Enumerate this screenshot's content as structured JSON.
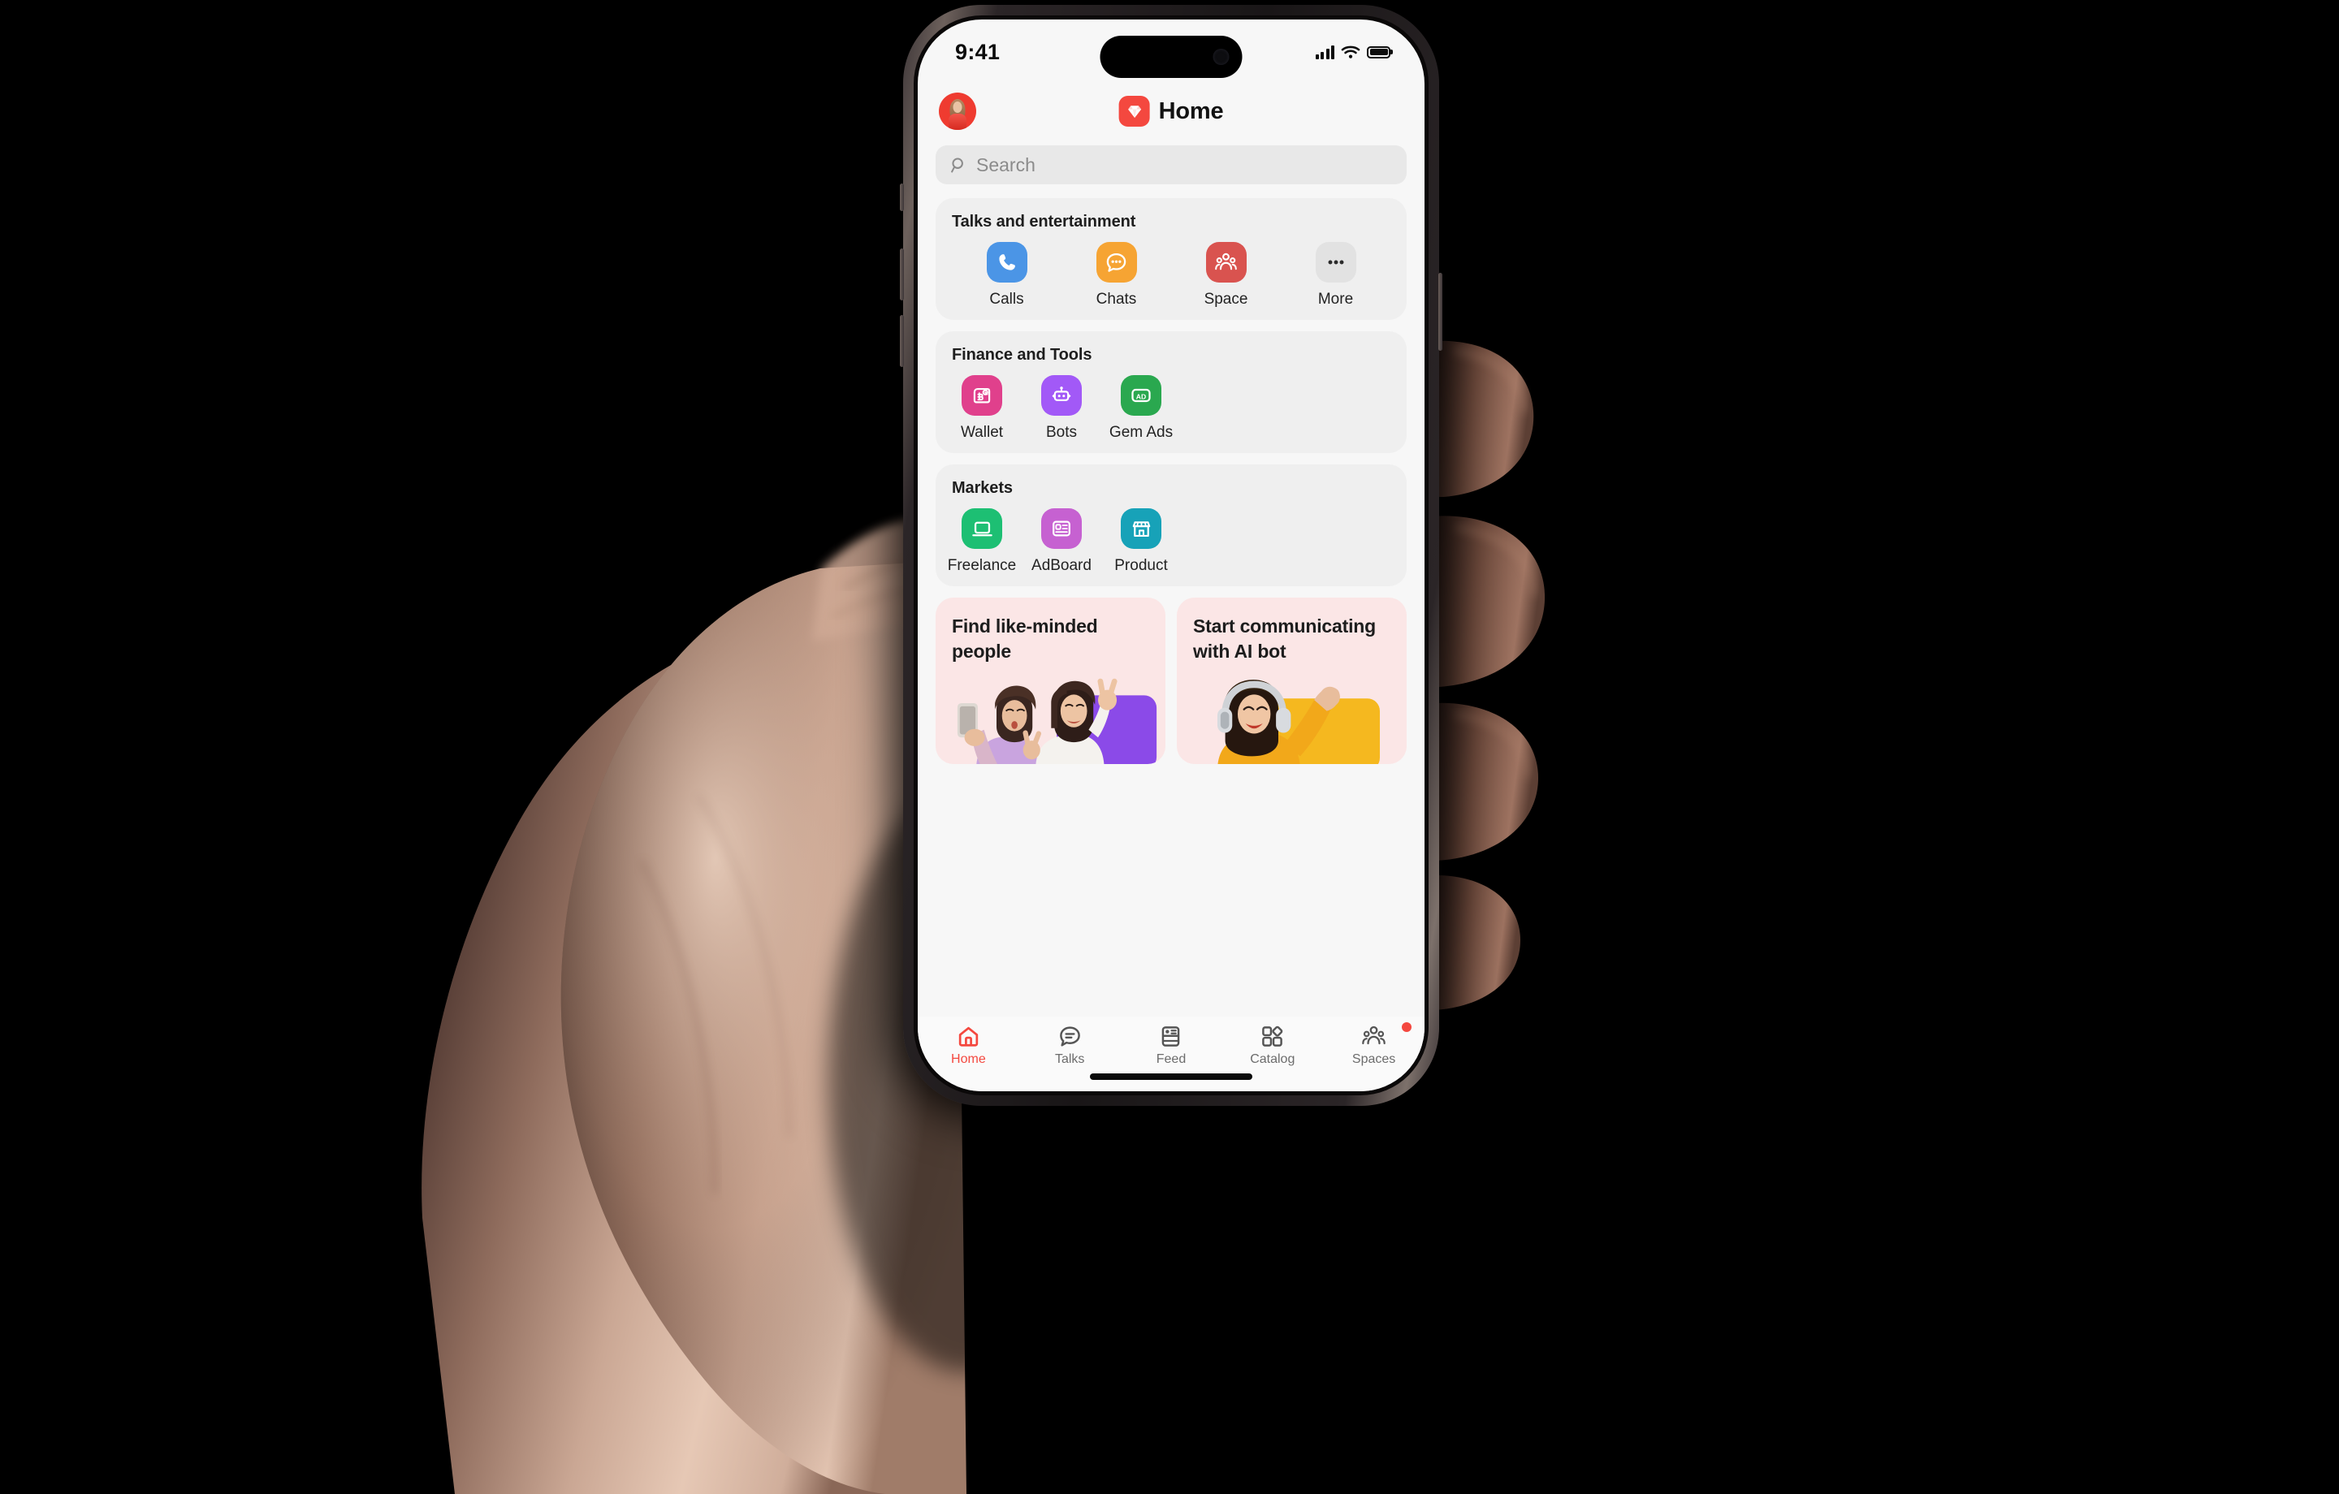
{
  "status_bar": {
    "time": "9:41",
    "cellular_icon": "signal-bars-icon",
    "wifi_icon": "wifi-icon",
    "battery_icon": "battery-icon"
  },
  "header": {
    "avatar_name": "user-avatar",
    "logo_icon": "gem-logo-icon",
    "title": "Home"
  },
  "search": {
    "placeholder": "Search",
    "icon": "search-icon",
    "value": ""
  },
  "sections": [
    {
      "title": "Talks and entertainment",
      "items": [
        {
          "label": "Calls",
          "icon": "phone-icon",
          "color": "#4b95e6"
        },
        {
          "label": "Chats",
          "icon": "chat-bubble-icon",
          "color": "#f6a433"
        },
        {
          "label": "Space",
          "icon": "people-group-icon",
          "color": "#d9534f"
        },
        {
          "label": "More",
          "icon": "ellipsis-icon",
          "color": "#e2e2e2"
        }
      ]
    },
    {
      "title": "Finance and Tools",
      "items": [
        {
          "label": "Wallet",
          "icon": "wallet-icon",
          "color": "#e0408c"
        },
        {
          "label": "Bots",
          "icon": "robot-icon",
          "color": "#a259f7"
        },
        {
          "label": "Gem Ads",
          "icon": "ad-badge-icon",
          "color": "#2aa84f"
        }
      ]
    },
    {
      "title": "Markets",
      "items": [
        {
          "label": "Freelance",
          "icon": "laptop-icon",
          "color": "#1dbf73"
        },
        {
          "label": "AdBoard",
          "icon": "id-card-icon",
          "color": "#c661d1"
        },
        {
          "label": "Product",
          "icon": "storefront-icon",
          "color": "#17a2b8"
        }
      ]
    }
  ],
  "promos": [
    {
      "title": "Find like-minded people",
      "art": "two-women-selfie-photo"
    },
    {
      "title": "Start communicating with AI bot",
      "art": "woman-headphones-photo"
    }
  ],
  "tabs": [
    {
      "label": "Home",
      "icon": "home-icon",
      "active": true,
      "badge": false
    },
    {
      "label": "Talks",
      "icon": "chat-lines-icon",
      "active": false,
      "badge": false
    },
    {
      "label": "Feed",
      "icon": "feed-card-icon",
      "active": false,
      "badge": false
    },
    {
      "label": "Catalog",
      "icon": "shapes-grid-icon",
      "active": false,
      "badge": false
    },
    {
      "label": "Spaces",
      "icon": "people-group-icon",
      "active": false,
      "badge": true
    }
  ],
  "colors": {
    "accent": "#f4483f",
    "screen_bg": "#f7f7f7",
    "card_bg": "#efefef",
    "promo_bg": "#fbe6e6",
    "search_bg": "#e8e8e8",
    "tab_inactive": "#6c6c6c"
  }
}
